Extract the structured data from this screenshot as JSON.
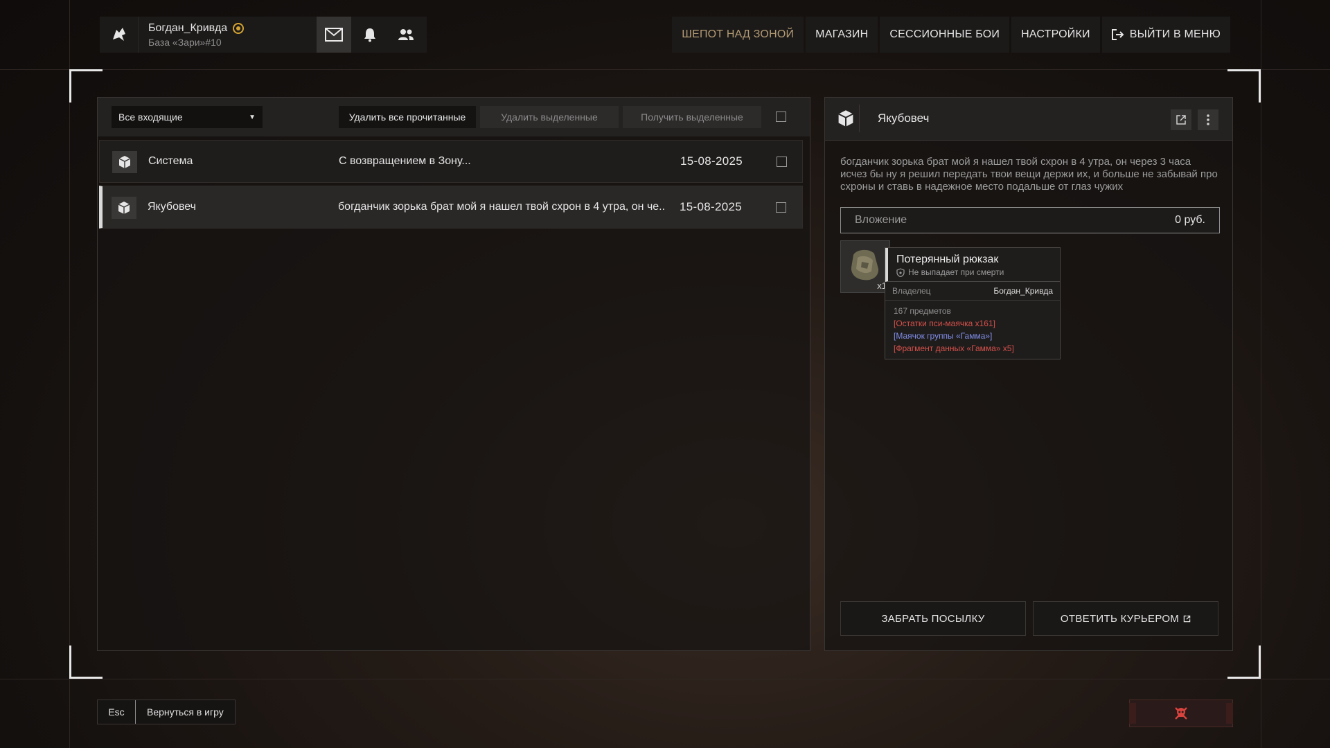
{
  "profile": {
    "name": "Богдан_Кривда",
    "base": "База «Зари»#10"
  },
  "topnav": {
    "whisper": "ШЕПОТ НАД ЗОНОЙ",
    "shop": "МАГАЗИН",
    "sessions": "СЕССИОННЫЕ БОИ",
    "settings": "НАСТРОЙКИ",
    "exit": "ВЫЙТИ В МЕНЮ"
  },
  "toolbar": {
    "filter": "Все входящие",
    "delete_read": "Удалить все прочитанные",
    "delete_selected": "Удалить выделенные",
    "receive_selected": "Получить выделенные"
  },
  "messages": [
    {
      "sender": "Система",
      "subject": "С возвращением в Зону...",
      "date": "15-08-2025"
    },
    {
      "sender": "Якубовеч",
      "subject": "богданчик зорька брат мой я нашел твой схрон в 4 утра, он че..",
      "date": "15-08-2025"
    }
  ],
  "detail": {
    "sender": "Якубовеч",
    "body": "богданчик зорька брат мой я нашел твой схрон в 4 утра, он через 3 часа исчез бы ну я решил передать твои вещи держи их, и больше не забывай про схроны и ставь в надежное место подальше от глаз чужих",
    "attachment_label": "Вложение",
    "attachment_value": "0 руб.",
    "item_qty": "x1",
    "item_name": "Потерянный рюкзак",
    "item_note": "Не выпадает при смерти",
    "owner_label": "Владелец",
    "owner_value": "Богдан_Кривда",
    "item_count": "167 предметов",
    "item_line1": "[Остатки пси-маячка x161]",
    "item_line2": "[Маячок группы «Гамма»]",
    "item_line3": "[Фрагмент данных «Гамма» x5]",
    "take_button": "ЗАБРАТЬ ПОСЫЛКУ",
    "reply_button": "ОТВЕТИТЬ КУРЬЕРОМ"
  },
  "bottom": {
    "esc_key": "Esc",
    "back_label": "Вернуться в игру"
  },
  "colors": {
    "accent_gold": "#b39b74",
    "badge": "#d5a332",
    "red": "#d6504a",
    "blue": "#7f8ce6",
    "skull": "#d8433e"
  }
}
